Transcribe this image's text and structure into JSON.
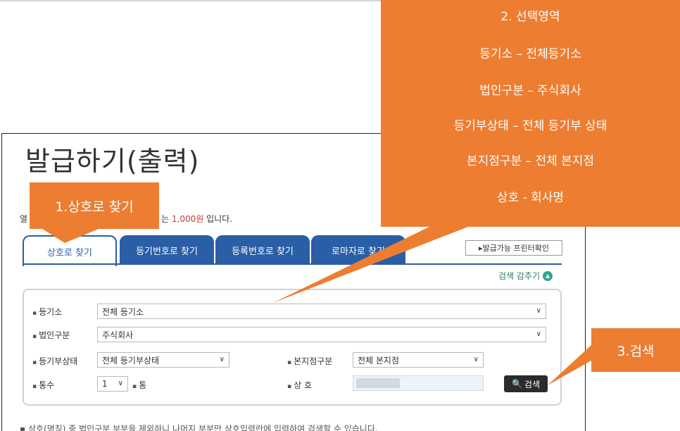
{
  "page": {
    "title": "발급하기(출력)",
    "fee_prefix": "열",
    "fee_middle": "는 ",
    "fee_price": "1,000원",
    "fee_suffix": " 입니다.",
    "printer_button": "▸발급가능 프린터확인",
    "hide_search_link": "검색 감추기",
    "footnote": "▪ 상호(명칭) 중 법인구분 부분을 제외하니 나머지 부분만 상호입력란에 입력하여 검색할 수 있습니다."
  },
  "tabs": [
    {
      "label": "상호로 찾기",
      "active": true
    },
    {
      "label": "등기번호로 찾기",
      "active": false
    },
    {
      "label": "등록번호로 찾기",
      "active": false
    },
    {
      "label": "로마자로 찾기",
      "active": false
    }
  ],
  "form": {
    "registry_office": {
      "label": "등기소",
      "value": "전체 등기소"
    },
    "corp_type": {
      "label": "법인구분",
      "value": "주식회사"
    },
    "registry_status": {
      "label": "등기부상태",
      "value": "전체 등기부상태"
    },
    "branch_type": {
      "label": "본지점구분",
      "value": "전체 본지점"
    },
    "copies": {
      "label": "통수",
      "value": "1",
      "unit": "통"
    },
    "company_name": {
      "label": "상 호",
      "value": ""
    },
    "search_button": "검색"
  },
  "callouts": {
    "step1": "1.상호로 찾기",
    "step2": [
      "2. 선택영역",
      "등기소 – 전체등기소",
      "법인구분 – 주식회사",
      "등기부상태 – 전체 등기부 상태",
      "본지점구분 – 전체 본지점",
      "상호 - 회사명"
    ],
    "step3": "3.검색"
  },
  "colors": {
    "callout": "#ed7d31",
    "tab_blue": "#2a5ea6",
    "price_red": "#c0392b"
  }
}
